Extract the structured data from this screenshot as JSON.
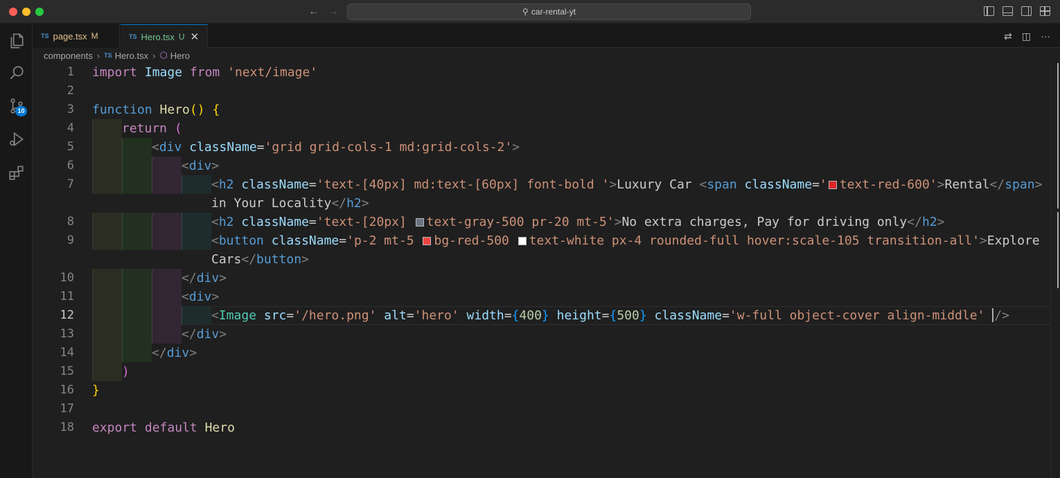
{
  "window": {
    "search_text": "car-rental-yt",
    "icons": [
      "back-arrow-icon",
      "forward-arrow-icon",
      "search-icon",
      "toggle-primary-sidebar-icon",
      "toggle-panel-icon",
      "toggle-secondary-sidebar-icon",
      "customize-layout-icon"
    ]
  },
  "activity_bar": {
    "items": [
      "explorer-icon",
      "search-icon",
      "source-control-icon",
      "run-debug-icon",
      "extensions-icon"
    ],
    "source_control_badge": "10"
  },
  "tabs": [
    {
      "lang": "TS",
      "label": "page.tsx",
      "status": "M",
      "active": false
    },
    {
      "lang": "TS",
      "label": "Hero.tsx",
      "status": "U",
      "active": true,
      "close": "✕"
    }
  ],
  "breadcrumb": {
    "folder": "components",
    "lang": "TS",
    "file": "Hero.tsx",
    "symbol": "Hero"
  },
  "editor": {
    "active_line": "12",
    "colors": {
      "red_600": "#dc2626",
      "gray_500": "#6b7280",
      "red_500": "#ef4444",
      "white": "#ffffff"
    },
    "lines": {
      "l1": "1",
      "l2": "2",
      "l3": "3",
      "l4": "4",
      "l5": "5",
      "l6": "6",
      "l7": "7",
      "l8": "8",
      "l9": "9",
      "l10": "10",
      "l11": "11",
      "l12": "12",
      "l13": "13",
      "l14": "14",
      "l15": "15",
      "l16": "16",
      "l17": "17",
      "l18": "18"
    },
    "tokens": {
      "import": "import",
      "image_id": "Image",
      "from": "from",
      "image_path": "'next/image'",
      "function": "function",
      "hero_fn": "Hero",
      "parens": "()",
      "open_brace": "{",
      "return": "return",
      "open_paren": "(",
      "div_open_1": "div",
      "classname": "className",
      "grid_cls": "'grid grid-cols-1 md:grid-cols-2'",
      "div": "div",
      "h2": "h2",
      "h2_cls_1": "'text-[40px] md:text-[60px] font-bold '",
      "luxury_car": "Luxury Car ",
      "span": "span",
      "span_cls_open": "'",
      "span_cls_rest": "text-red-600'",
      "rental": "Rental",
      "in_locality": "in Your Locality",
      "h2_cls_2a": "'text-[20px] ",
      "h2_cls_2b": "text-gray-500 pr-20 mt-5'",
      "no_extra": "No extra charges, Pay for driving only",
      "button": "button",
      "btn_cls_a": "'p-2 mt-5 ",
      "btn_cls_b": "bg-red-500 ",
      "btn_cls_c": "text-white px-4 rounded-full hover:scale-105 transition-all'",
      "explore": "Explore",
      "cars": "Cars",
      "img_tag": "Image",
      "src": "src",
      "src_val": "'/hero.png'",
      "alt": "alt",
      "alt_val": "'hero'",
      "width": "width",
      "width_val": "400",
      "height": "height",
      "height_val": "500",
      "img_cls": "'w-full object-cover align-middle'",
      "close_paren": ")",
      "close_brace": "}",
      "export": "export",
      "default": "default",
      "hero_export": "Hero"
    }
  }
}
